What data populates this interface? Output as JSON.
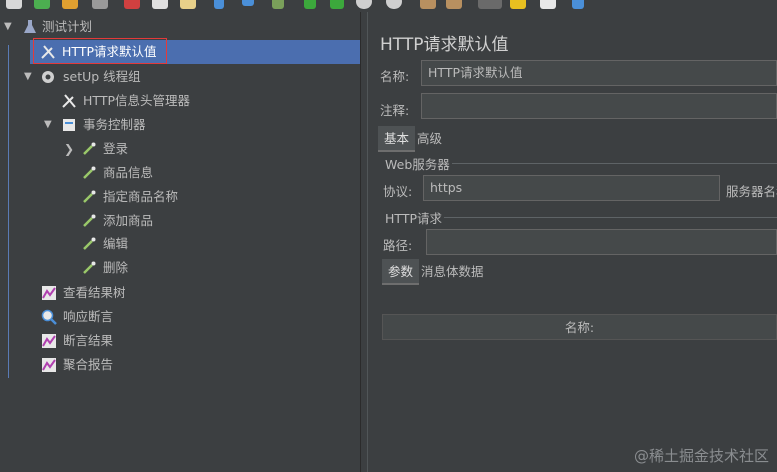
{
  "tree": {
    "root": "测试计划",
    "items": [
      {
        "label": "HTTP请求默认值",
        "icon": "wrench-icon"
      },
      {
        "label": "setUp 线程组",
        "icon": "gear-icon"
      },
      {
        "label": "HTTP信息头管理器",
        "icon": "wrench-icon"
      },
      {
        "label": "事务控制器",
        "icon": "controller-icon"
      },
      {
        "label": "登录",
        "icon": "pipette-icon"
      },
      {
        "label": "商品信息",
        "icon": "pipette-icon"
      },
      {
        "label": "指定商品名称",
        "icon": "pipette-icon"
      },
      {
        "label": "添加商品",
        "icon": "pipette-icon"
      },
      {
        "label": "编辑",
        "icon": "pipette-icon"
      },
      {
        "label": "删除",
        "icon": "pipette-icon"
      },
      {
        "label": "查看结果树",
        "icon": "chart-icon"
      },
      {
        "label": "响应断言",
        "icon": "magnifier-icon"
      },
      {
        "label": "断言结果",
        "icon": "chart-icon"
      },
      {
        "label": "聚合报告",
        "icon": "chart-icon"
      }
    ]
  },
  "panel": {
    "title": "HTTP请求默认值",
    "name_label": "名称:",
    "name_value": "HTTP请求默认值",
    "comment_label": "注释:",
    "comment_value": "",
    "tabs": [
      "基本",
      "高级"
    ],
    "web_server_group": "Web服务器",
    "protocol_label": "协议:",
    "protocol_value": "https",
    "server_name_label": "服务器名称",
    "http_request_group": "HTTP请求",
    "path_label": "路径:",
    "path_value": "",
    "subtabs": [
      "参数",
      "消息体数据"
    ],
    "table_header": "名称:"
  },
  "watermark": "@稀土掘金技术社区",
  "colors": {
    "background": "#3c3f41",
    "selection": "#4b6eaf",
    "highlight_box": "#e33a3a",
    "input_bg": "#45494a"
  }
}
